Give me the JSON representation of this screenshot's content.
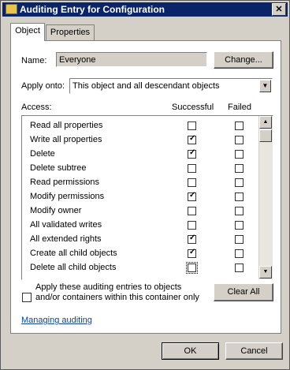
{
  "window": {
    "title": "Auditing Entry for Configuration",
    "close_label": "✕"
  },
  "tabs": [
    {
      "label": "Object"
    },
    {
      "label": "Properties"
    }
  ],
  "name": {
    "label": "Name:",
    "value": "Everyone",
    "change_label": "Change..."
  },
  "apply_onto": {
    "label": "Apply onto:",
    "value": "This object and all descendant objects"
  },
  "access": {
    "header_access": "Access:",
    "header_successful": "Successful",
    "header_failed": "Failed",
    "rows": [
      {
        "label": "Read all properties",
        "successful": false,
        "failed": false
      },
      {
        "label": "Write all properties",
        "successful": true,
        "failed": false
      },
      {
        "label": "Delete",
        "successful": true,
        "failed": false
      },
      {
        "label": "Delete subtree",
        "successful": false,
        "failed": false
      },
      {
        "label": "Read permissions",
        "successful": false,
        "failed": false
      },
      {
        "label": "Modify permissions",
        "successful": true,
        "failed": false
      },
      {
        "label": "Modify owner",
        "successful": false,
        "failed": false
      },
      {
        "label": "All validated writes",
        "successful": false,
        "failed": false
      },
      {
        "label": "All extended rights",
        "successful": true,
        "failed": false
      },
      {
        "label": "Create all child objects",
        "successful": true,
        "failed": false
      },
      {
        "label": "Delete all child objects",
        "successful": false,
        "failed": false
      }
    ]
  },
  "apply_checkbox": {
    "label": "Apply these auditing entries to objects and/or containers within this container only",
    "checked": false
  },
  "clear_all_label": "Clear All",
  "managing_link": "Managing auditing",
  "footer": {
    "ok_label": "OK",
    "cancel_label": "Cancel"
  }
}
